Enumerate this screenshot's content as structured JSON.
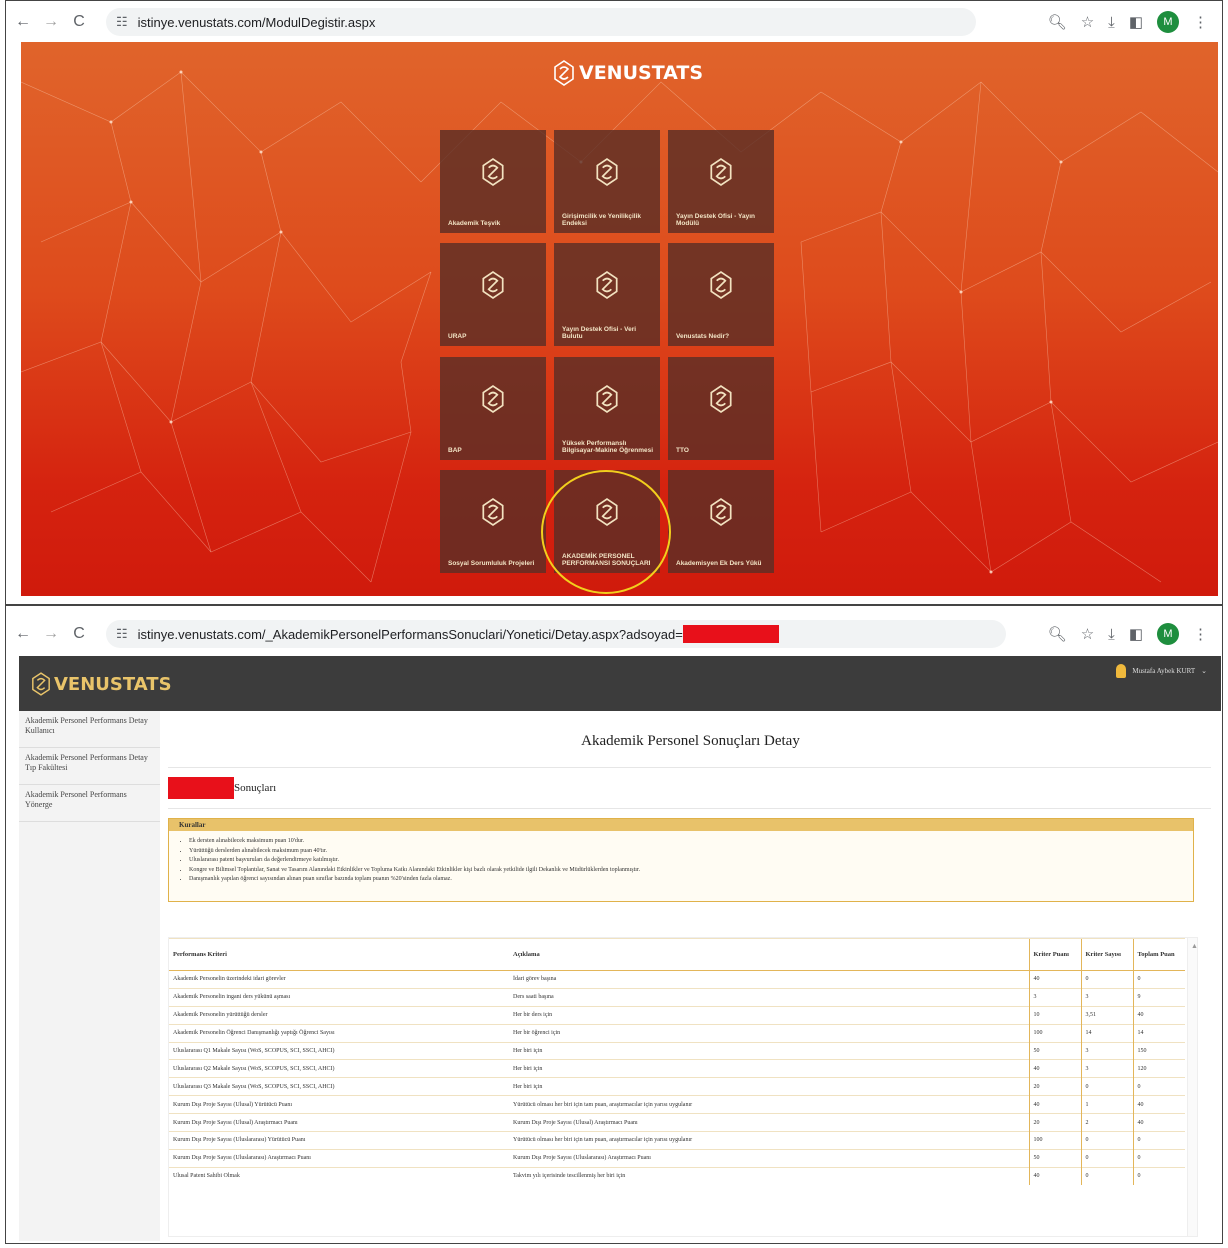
{
  "browser1": {
    "url": "istinye.venustats.com/ModulDegistir.aspx",
    "profile_initial": "M",
    "icons": [
      "back-icon",
      "forward-icon",
      "reload-icon",
      "tune-icon",
      "zoom-icon",
      "star-icon",
      "download-icon",
      "sidepanel-icon",
      "menu-icon"
    ]
  },
  "landing": {
    "brand": "VENUSTATS",
    "tiles": [
      {
        "label": "Akademik Teşvik"
      },
      {
        "label": "Girişimcilik ve Yenilikçilik Endeksi"
      },
      {
        "label": "Yayın Destek Ofisi - Yayın Modülü"
      },
      {
        "label": "URAP"
      },
      {
        "label": "Yayın Destek Ofisi - Veri Bulutu"
      },
      {
        "label": "Venustats Nedir?"
      },
      {
        "label": "BAP"
      },
      {
        "label": "Yüksek Performanslı Bilgisayar-Makine Öğrenmesi"
      },
      {
        "label": "TTO"
      },
      {
        "label": "Sosyal Sorumluluk Projeleri"
      },
      {
        "label": "AKADEMİK PERSONEL PERFORMANSI SONUÇLARI"
      },
      {
        "label": "Akademisyen Ek Ders Yükü"
      }
    ],
    "highlight_color": "#f2cf1d"
  },
  "browser2": {
    "url": "istinye.venustats.com/_AkademikPersonelPerformansSonuclari/Yonetici/Detay.aspx?adsoyad=",
    "profile_initial": "M"
  },
  "app": {
    "brand": "VENUSTATS",
    "user_name": "Mustafa Aybek KURT",
    "sidebar": [
      "Akademik Personel Performans Detay Kullanıcı",
      "Akademik Personel Performans Detay Tıp Fakültesi",
      "Akademik Personel Performans Yönerge"
    ],
    "page_title": "Akademik Personel Sonuçları Detay",
    "subtitle_suffix": "Sonuçları",
    "rules_title": "Kurallar",
    "rules": [
      "Ek dersten alınabilecek maksimum puan 10'dur.",
      "Yürüttüğü derslerden alınabilecek maksimum puan 40'tır.",
      "Uluslararası patent başvuruları da değerlendirmeye katılmıştır.",
      "Kongre ve Bilimsel Toplantılar, Sanat ve Tasarım Alanındaki Etkinlikler ve Topluma Katkı Alanındaki Etkinlikler kişi bazlı olarak yetkilide ilgili Dekanlık ve Müdürlüklerden toplanmıştır.",
      "Danışmanlık yapılan öğrenci sayısından alınan puan sınıflar bazında toplam puanın %20'sinden fazla olamaz."
    ],
    "table": {
      "headers": [
        "Performans Kriteri",
        "Açıklama",
        "Kriter Puanı",
        "Kriter Sayısı",
        "Toplam Puan"
      ],
      "rows": [
        [
          "Akademik Personelin üzerindeki idari görevler",
          "İdari görev başına",
          "40",
          "0",
          "0"
        ],
        [
          "Akademik Personelin ingani ders yükünü aşması",
          "Ders saati başına",
          "3",
          "3",
          "9"
        ],
        [
          "Akademik Personelin yürüttüğü dersler",
          "Her bir ders için",
          "10",
          "3,51",
          "40"
        ],
        [
          "Akademik Personelin Öğrenci Danışmanlığı yaptığı Öğrenci Sayısı",
          "Her bir öğrenci için",
          "100",
          "14",
          "14"
        ],
        [
          "Uluslararası Q1 Makale Sayısı (WoS, SCOPUS, SCI, SSCI, AHCI)",
          "Her biri için",
          "50",
          "3",
          "150"
        ],
        [
          "Uluslararası Q2 Makale Sayısı (WoS, SCOPUS, SCI, SSCI, AHCI)",
          "Her biri için",
          "40",
          "3",
          "120"
        ],
        [
          "Uluslararası Q3 Makale Sayısı (WoS, SCOPUS, SCI, SSCI, AHCI)",
          "Her biri için",
          "20",
          "0",
          "0"
        ],
        [
          "Kurum Dışı Proje Sayısı (Ulusal) Yürütücü Puanı",
          "Yürütücü olması her biri için tam puan, araştırmacılar için yarısı uygulanır",
          "40",
          "1",
          "40"
        ],
        [
          "Kurum Dışı Proje Sayısı (Ulusal) Araştırmacı Puanı",
          "Kurum Dışı Proje Sayısı (Ulusal) Araştırmacı Puanı",
          "20",
          "2",
          "40"
        ],
        [
          "Kurum Dışı Proje Sayısı (Uluslararası) Yürütücü Puanı",
          "Yürütücü olması her biri için tam puan, araştırmacılar için yarısı uygulanır",
          "100",
          "0",
          "0"
        ],
        [
          "Kurum Dışı Proje Sayısı (Uluslararası) Araştırmacı Puanı",
          "Kurum Dışı Proje Sayısı (Uluslararası) Araştırmacı Puanı",
          "50",
          "0",
          "0"
        ],
        [
          "Ulusal Patent Sahibi Olmak",
          "Takvim yılı içerisinde tescillenmiş her biri için",
          "40",
          "0",
          "0"
        ]
      ]
    }
  }
}
